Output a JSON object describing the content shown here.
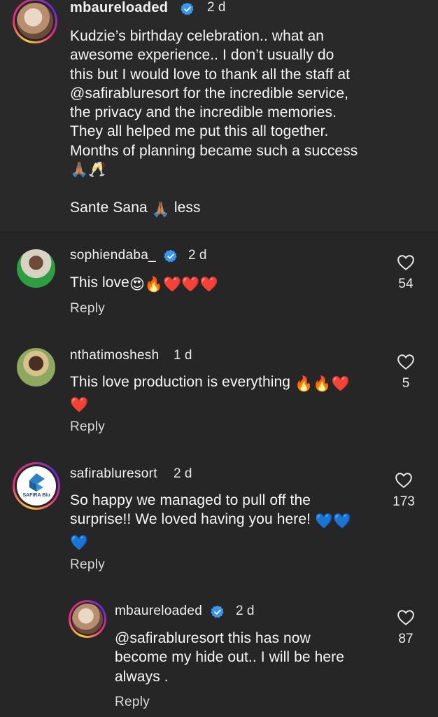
{
  "caption": {
    "username": "mbaureloaded",
    "time": "2 d",
    "lines": [
      "Kudzie’s birthday celebration.. what an",
      "awesome experience.. I don’t usually do",
      "this but I would love to thank all the staff at",
      "@safirabluresort for the incredible service,",
      "the privacy and the incredible memories.",
      "They all helped me put this all together.",
      "Months of planning became such a success"
    ],
    "emoji_line": "🙏🏽🥂",
    "closing_prefix": "Sante Sana ",
    "closing_emoji": "🙏🏽",
    "less_label": " less"
  },
  "comments": [
    {
      "username": "sophiendaba_",
      "time": "2 d",
      "verified": true,
      "text_prefix": "This love",
      "text_emoji": "😍🔥❤️❤️❤️",
      "likes": "54",
      "reply_label": "Reply"
    },
    {
      "username": "nthatimoshesh",
      "time": "1 d",
      "verified": false,
      "text_line1": "This love production is everything ",
      "text_line1_emoji": "🔥🔥❤️",
      "text_line2_emoji": "❤️",
      "likes": "5",
      "reply_label": "Reply"
    },
    {
      "username": "safirabluresort",
      "time": "2 d",
      "verified": false,
      "text_line1": "So happy we managed to pull off the",
      "text_line2": "surprise!! We loved having you here! ",
      "text_line2_emoji": "💙💙",
      "text_line3_emoji": "💙",
      "likes": "173",
      "reply_label": "Reply",
      "avatar_logo_text": "SAFIRA Blu"
    },
    {
      "username": "mbaureloaded",
      "time": "2 d",
      "verified": true,
      "text_lines": [
        "@safirabluresort this has now",
        "become my hide out.. I will be here",
        "always ."
      ],
      "likes": "87",
      "reply_label": "Reply"
    }
  ],
  "colors": {
    "background": "#262626",
    "verified_blue": "#3897f0",
    "text": "#f5f5f5"
  },
  "icons": {
    "like": "heart-outline-icon",
    "verified": "verified-badge-icon"
  }
}
